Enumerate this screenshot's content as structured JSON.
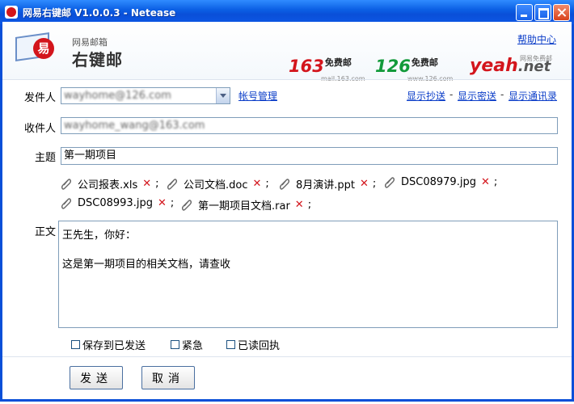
{
  "window": {
    "title": "网易右键邮 V1.0.0.3 - Netease"
  },
  "header": {
    "logo_small": "网易邮箱",
    "logo_big": "右键邮",
    "logo_badge": "易",
    "help_link": "帮助中心",
    "brands": [
      {
        "num": "163",
        "free": "免费邮",
        "sub": "mail.163.com"
      },
      {
        "num": "126",
        "free": "免费邮",
        "sub": "www.126.com"
      },
      {
        "num": "yeah",
        "net": ".net",
        "sub": "网易免费邮"
      }
    ]
  },
  "form": {
    "from_label": "发件人",
    "from_value": "wayhome@126.com",
    "account_link": "帐号管理",
    "show_cc": "显示抄送",
    "show_bcc": "显示密送",
    "show_contacts": "显示通讯录",
    "dash": "-",
    "to_label": "收件人",
    "to_value": "wayhome_wang@163.com",
    "subject_label": "主题",
    "subject_value": "第一期项目",
    "body_label": "正文",
    "body_lines": [
      "王先生，你好：",
      "这是第一期项目的相关文档，请查收"
    ]
  },
  "attachments": [
    {
      "name": "公司报表.xls",
      "remove": "✕",
      "sep": ";"
    },
    {
      "name": "公司文档.doc",
      "remove": "✕",
      "sep": ";"
    },
    {
      "name": "8月演讲.ppt",
      "remove": "✕",
      "sep": ";"
    },
    {
      "name": "DSC08979.jpg",
      "remove": "✕",
      "sep": ";"
    },
    {
      "name": "DSC08993.jpg",
      "remove": "✕",
      "sep": ";"
    },
    {
      "name": "第一期项目文档.rar",
      "remove": "✕",
      "sep": ";"
    }
  ],
  "options": {
    "save_sent": "保存到已发送",
    "urgent": "紧急",
    "read_receipt": "已读回执"
  },
  "buttons": {
    "send": "发送",
    "cancel": "取消"
  },
  "colors": {
    "title_bar": "#0a4fd8",
    "link": "#0a3cc8",
    "remove_red": "#d3151c",
    "accent_163": "#d3151c",
    "accent_126": "#129a3a"
  }
}
